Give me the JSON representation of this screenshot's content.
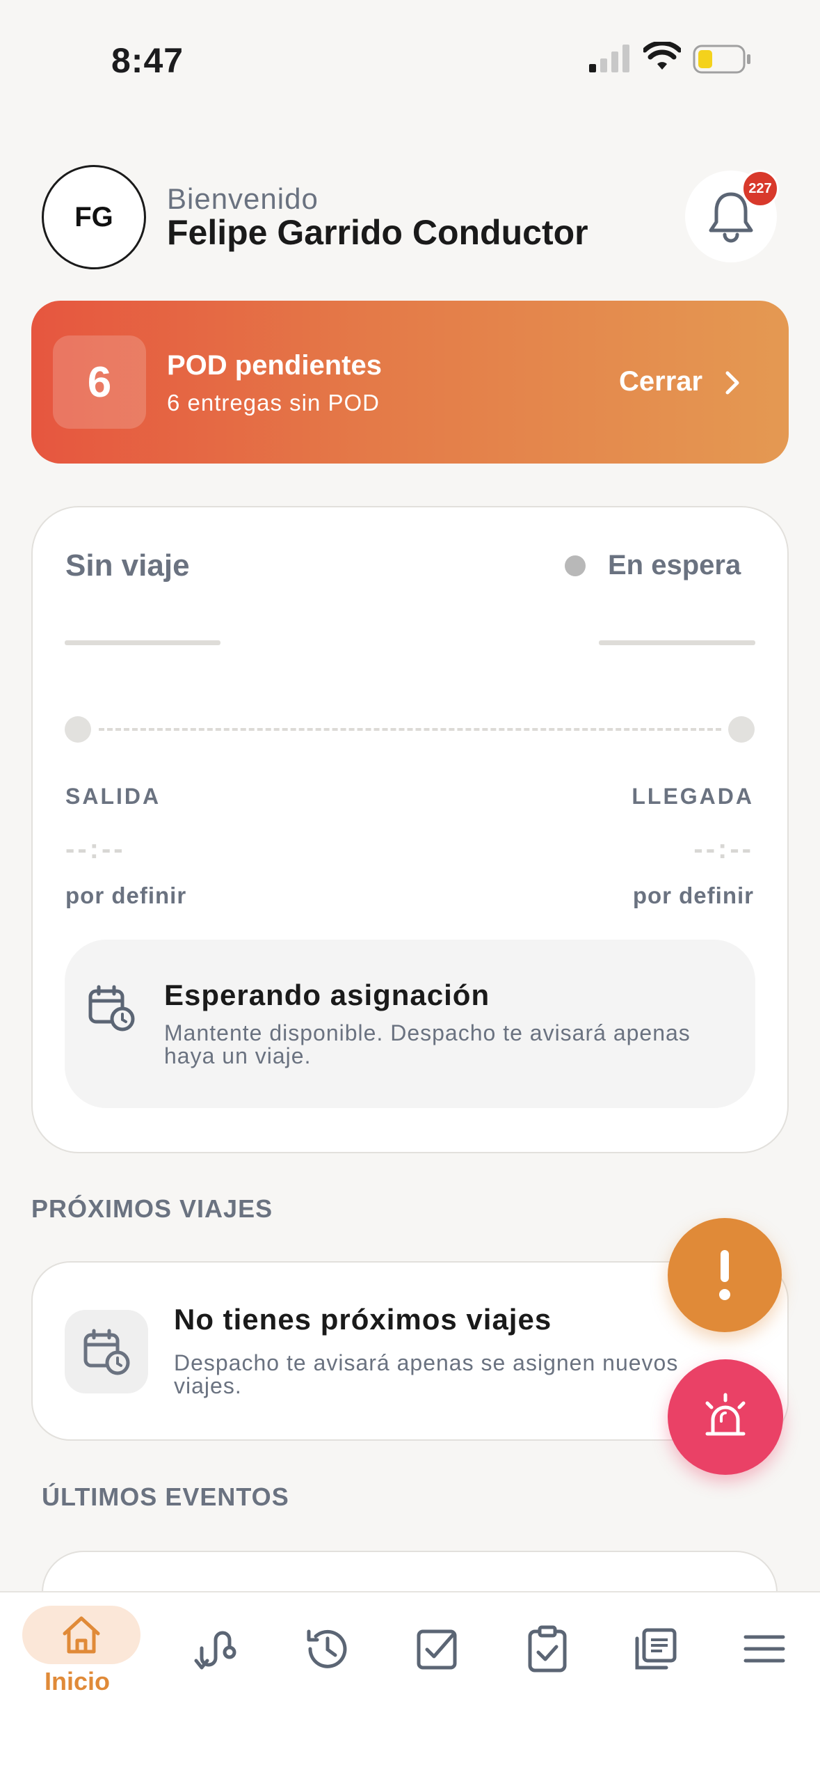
{
  "status_bar": {
    "time": "8:47"
  },
  "header": {
    "avatar_initials": "FG",
    "welcome": "Bienvenido",
    "user_name": "Felipe Garrido Conductor",
    "notification_count": "227"
  },
  "pod_banner": {
    "count": "6",
    "title": "POD pendientes",
    "subtitle": "6 entregas sin POD",
    "action_label": "Cerrar"
  },
  "trip_card": {
    "title": "Sin viaje",
    "status": "En espera",
    "departure_label": "SALIDA",
    "arrival_label": "LLEGADA",
    "departure_time": "--:--",
    "arrival_time": "--:--",
    "departure_note": "por definir",
    "arrival_note": "por definir",
    "assignment_title": "Esperando asignación",
    "assignment_desc": "Mantente disponible. Despacho te avisará apenas haya un viaje."
  },
  "upcoming": {
    "section_title": "PRÓXIMOS VIAJES",
    "empty_title": "No tienes próximos viajes",
    "empty_desc": "Despacho te avisará apenas se asignen nuevos viajes."
  },
  "events": {
    "section_title": "ÚLTIMOS EVENTOS"
  },
  "nav": {
    "active_label": "Inicio",
    "items": [
      "home-icon",
      "route-icon",
      "history-icon",
      "checkbox-icon",
      "clipboard-check-icon",
      "documents-icon",
      "menu-icon"
    ]
  },
  "colors": {
    "accent_orange": "#e08a38",
    "sos_pink": "#ea4166",
    "banner_start": "#e6563f",
    "banner_end": "#e49952",
    "badge_red": "#d8392b"
  }
}
